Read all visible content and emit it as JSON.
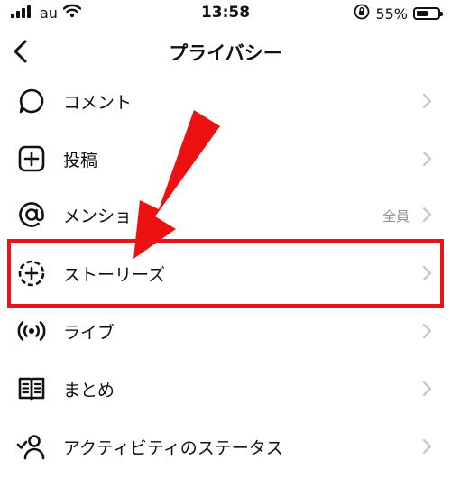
{
  "status_bar": {
    "carrier": "au",
    "time": "13:58",
    "battery_percent": "55%",
    "battery_level": 0.55
  },
  "nav": {
    "title": "プライバシー"
  },
  "menu": [
    {
      "label": "コメント",
      "icon": "comment-bubble-icon",
      "value": ""
    },
    {
      "label": "投稿",
      "icon": "plus-square-icon",
      "value": ""
    },
    {
      "label": "メンショ",
      "icon": "at-sign-icon",
      "value": "全員"
    },
    {
      "label": "ストーリーズ",
      "icon": "story-dashed-plus-icon",
      "value": ""
    },
    {
      "label": "ライブ",
      "icon": "live-broadcast-icon",
      "value": ""
    },
    {
      "label": "まとめ",
      "icon": "guide-book-icon",
      "value": ""
    },
    {
      "label": "アクティビティのステータス",
      "icon": "person-check-icon",
      "value": ""
    }
  ],
  "annotation": {
    "highlight_color": "#e8131b",
    "arrow_color": "#ee1111"
  }
}
